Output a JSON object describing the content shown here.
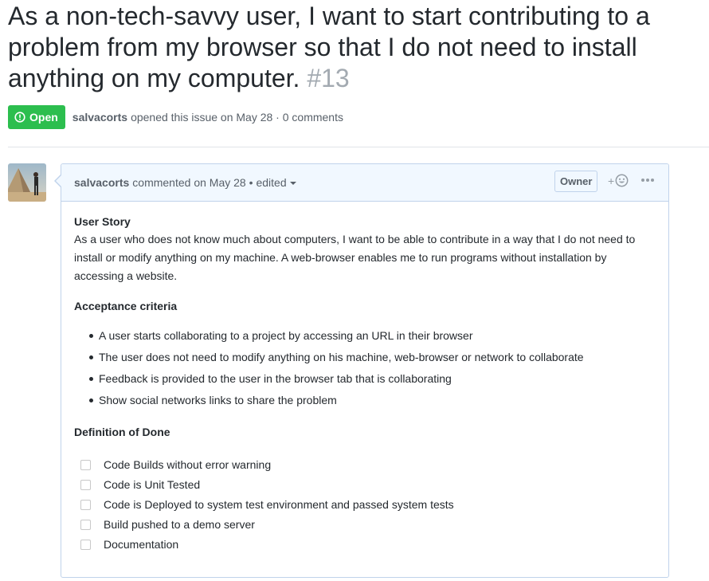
{
  "issue": {
    "title": "As a non-tech-savvy user, I want to start contributing to a problem from my browser so that I do not need to install anything on my computer.",
    "number": "#13",
    "state": "Open",
    "author": "salvacorts",
    "opened_text": "opened this issue on May 28 · 0 comments"
  },
  "comment": {
    "author": "salvacorts",
    "commented_text": "commented on May 28 •",
    "edited_label": "edited",
    "owner_badge": "Owner",
    "reaction_plus": "+",
    "body": {
      "user_story_heading": "User Story",
      "user_story_text": "As a user who does not know much about computers, I want to be able to contribute in a way that I do not need to install or modify anything on my machine. A web-browser enables me to run programs without installation by accessing a website.",
      "acceptance_heading": "Acceptance criteria",
      "acceptance_items": [
        "A user starts collaborating to a project by accessing an URL in their browser",
        "The user does not need to modify anything on his machine, web-browser or network to collaborate",
        "Feedback is provided to the user in the browser tab that is collaborating",
        "Show social networks links to share the problem"
      ],
      "dod_heading": "Definition of Done",
      "dod_items": [
        "Code Builds without error warning",
        "Code is Unit Tested",
        "Code is Deployed to system test environment and passed system tests",
        "Build pushed to a demo server",
        "Documentation"
      ]
    }
  },
  "colors": {
    "open_badge": "#2cbe4e",
    "header_bg": "#f1f8ff",
    "border": "#c0d3eb",
    "muted_text": "#586069",
    "number_gray": "#a3aab1"
  },
  "icons": {
    "state": "issue-opened-icon",
    "reaction": "smiley-icon",
    "more": "kebab-horizontal-icon",
    "edited_dropdown": "triangle-down-icon"
  }
}
